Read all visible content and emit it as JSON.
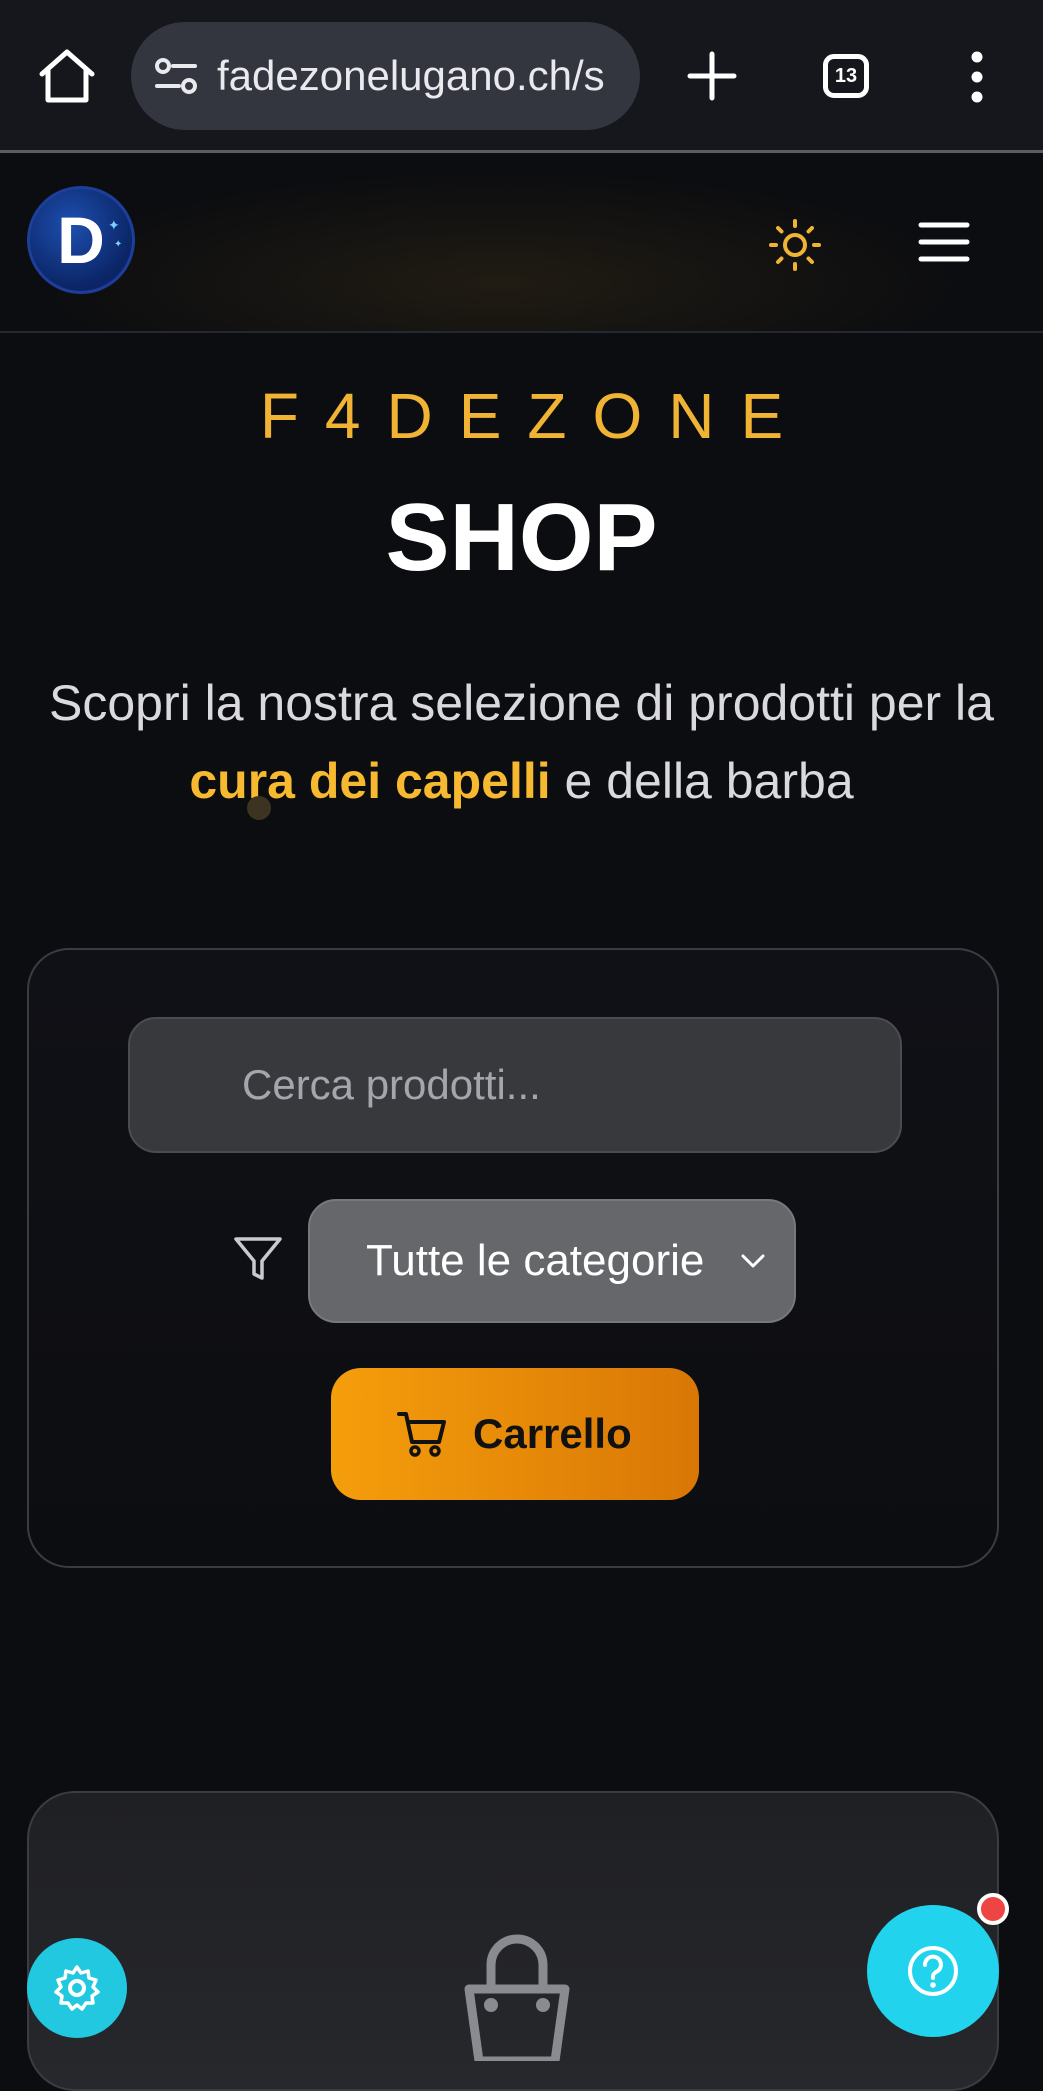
{
  "browser": {
    "url": "fadezonelugano.ch/s",
    "tab_count": "13"
  },
  "header": {
    "logo_letter": "D"
  },
  "hero": {
    "brand": "F4DEZONE",
    "title": "SHOP",
    "subtitle_before": "Scopri la nostra selezione di prodotti per la ",
    "subtitle_highlight": "cura dei capelli",
    "subtitle_after": " e della barba"
  },
  "filters": {
    "search_placeholder": "Cerca prodotti...",
    "category_selected": "Tutte le categorie",
    "cart_label": "Carrello"
  },
  "colors": {
    "accent": "#f0b334",
    "cart_button": "#f59e0b",
    "fab": "#22d3ee",
    "notification": "#ef4444"
  },
  "icons": [
    "home-icon",
    "site-settings-icon",
    "plus-icon",
    "more-vert-icon",
    "sun-icon",
    "menu-icon",
    "filter-icon",
    "chevron-down-icon",
    "cart-icon",
    "shopping-bag-icon",
    "gear-icon",
    "help-icon"
  ]
}
